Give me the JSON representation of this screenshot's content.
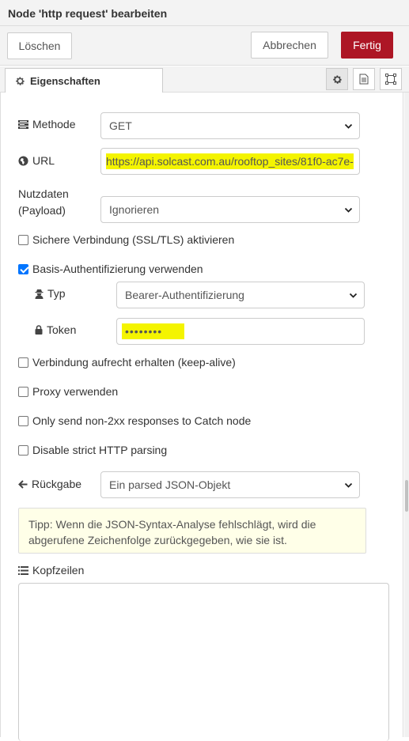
{
  "title": "Node 'http request' bearbeiten",
  "actions": {
    "delete": "Löschen",
    "cancel": "Abbrechen",
    "done": "Fertig"
  },
  "tab": {
    "label": "Eigenschaften"
  },
  "colors": {
    "primary": "#ad1625",
    "highlight": "#f4f400",
    "tip_bg": "#ffffe8",
    "checkbox": "#0075ff"
  },
  "form": {
    "method": {
      "label": "Methode",
      "value": "GET"
    },
    "url": {
      "label": "URL",
      "value": "https://api.solcast.com.au/rooftop_sites/81f0-ac7e-"
    },
    "payload": {
      "label_line1": "Nutzdaten",
      "label_line2": "(Payload)",
      "value": "Ignorieren"
    },
    "ssl": {
      "label": "Sichere Verbindung (SSL/TLS) aktivieren",
      "checked": false
    },
    "basic_auth": {
      "label": "Basis-Authentifizierung verwenden",
      "checked": true
    },
    "auth_type": {
      "label": "Typ",
      "value": "Bearer-Authentifizierung"
    },
    "token": {
      "label": "Token",
      "value": "••••••••"
    },
    "keepalive": {
      "label": "Verbindung aufrecht erhalten (keep-alive)",
      "checked": false
    },
    "proxy": {
      "label": "Proxy verwenden",
      "checked": false
    },
    "non2xx": {
      "label": "Only send non-2xx responses to Catch node",
      "checked": false
    },
    "strict": {
      "label": "Disable strict HTTP parsing",
      "checked": false
    },
    "return": {
      "label": "Rückgabe",
      "value": "Ein parsed JSON-Objekt"
    },
    "tip": "Tipp: Wenn die JSON-Syntax-Analyse fehlschlägt, wird die abgerufene Zeichenfolge zurückgegeben, wie sie ist.",
    "headers": {
      "label": "Kopfzeilen"
    }
  }
}
